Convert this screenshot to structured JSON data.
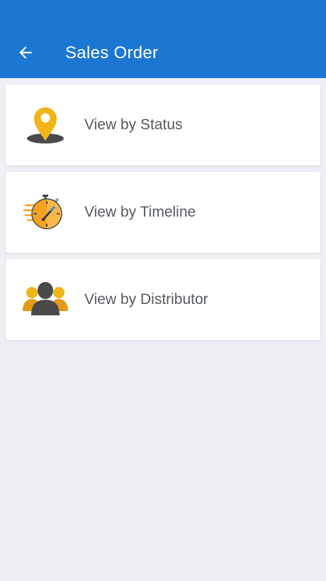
{
  "header": {
    "title": "Sales Order",
    "back_icon": "arrow-left-icon",
    "background": "#1b77d2"
  },
  "menu": {
    "items": [
      {
        "label": "View by Status",
        "icon": "map-pin-icon"
      },
      {
        "label": "View by Timeline",
        "icon": "stopwatch-icon"
      },
      {
        "label": "View by Distributor",
        "icon": "users-group-icon"
      }
    ]
  },
  "colors": {
    "accent_yellow": "#f2b517",
    "accent_orange": "#f4a21d",
    "icon_dark": "#4a4a4a",
    "page_background": "#eff0f5"
  }
}
